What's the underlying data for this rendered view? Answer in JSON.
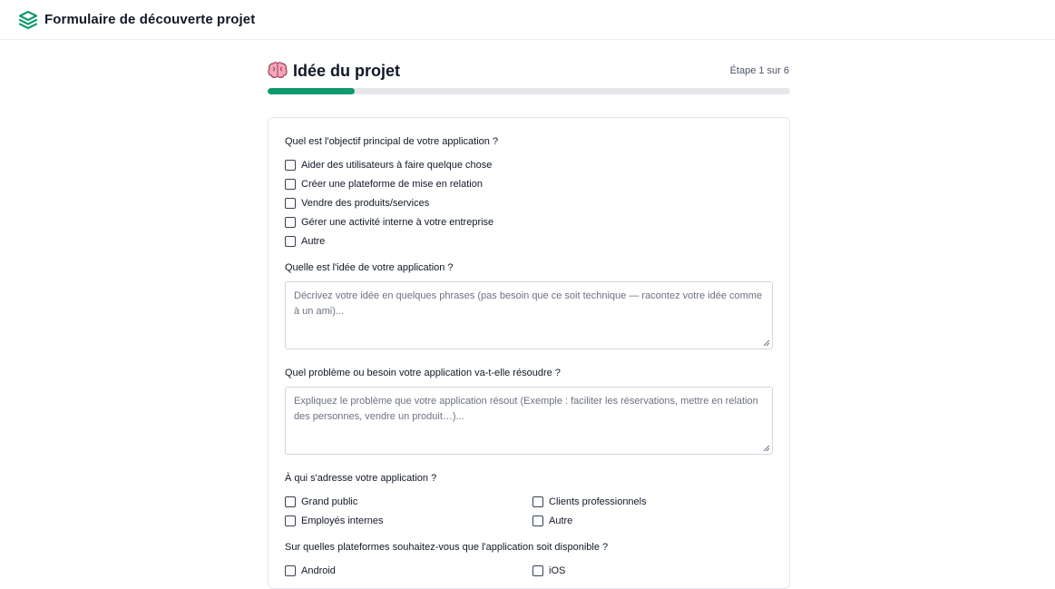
{
  "header": {
    "title": "Formulaire de découverte projet",
    "logo_icon": "layers-icon"
  },
  "step": {
    "icon": "brain-icon",
    "title": "Idée du projet",
    "counter": "Étape 1 sur 6",
    "progress": 0.1667
  },
  "colors": {
    "accent": "#0f9a6e",
    "track": "#e5e7eb",
    "text": "#111827"
  },
  "questions": {
    "objective": {
      "label": "Quel est l'objectif principal de votre application ?",
      "options": [
        "Aider des utilisateurs à faire quelque chose",
        "Créer une plateforme de mise en relation",
        "Vendre des produits/services",
        "Gérer une activité interne à votre entreprise",
        "Autre"
      ]
    },
    "idea": {
      "label": "Quelle est l'idée de votre application ?",
      "placeholder": "Décrivez votre idée en quelques phrases (pas besoin que ce soit technique — racontez votre idée comme à un ami)..."
    },
    "problem": {
      "label": "Quel problème ou besoin votre application va-t-elle résoudre ?",
      "placeholder": "Expliquez le problème que votre application résout (Exemple : faciliter les réservations, mettre en relation des personnes, vendre un produit…)..."
    },
    "audience": {
      "label": "À qui s'adresse votre application ?",
      "options": [
        "Grand public",
        "Clients professionnels",
        "Employés internes",
        "Autre"
      ]
    },
    "platforms": {
      "label": "Sur quelles plateformes souhaitez-vous que l'application soit disponible ?",
      "options": [
        "Android",
        "iOS"
      ]
    }
  }
}
